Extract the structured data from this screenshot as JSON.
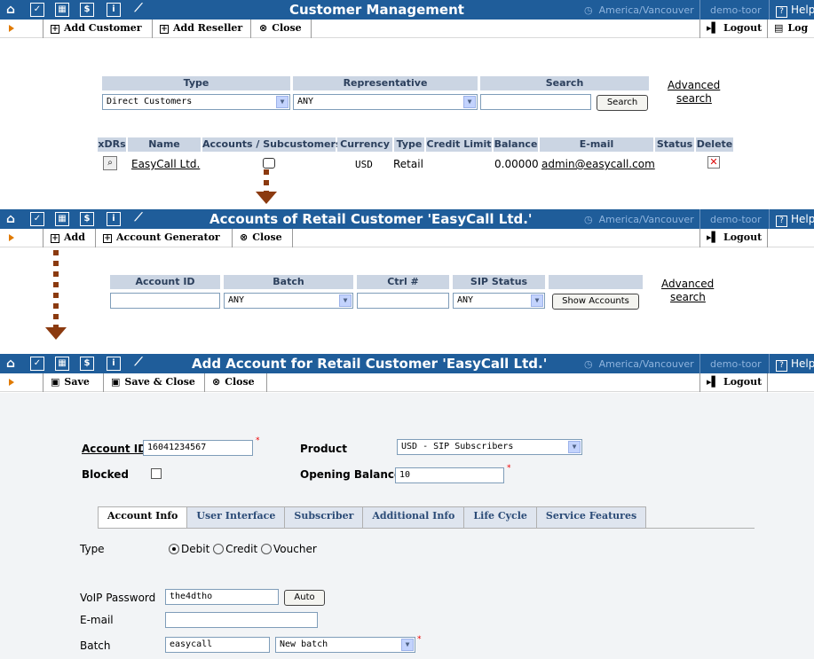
{
  "common": {
    "timezone": "America/Vancouver",
    "user": "demo-toor",
    "help": "Help",
    "logout": "Logout",
    "log_label": "Log"
  },
  "screen1": {
    "title": "Customer Management",
    "toolbar": {
      "add_customer": "Add Customer",
      "add_reseller": "Add Reseller",
      "close": "Close"
    },
    "filters": {
      "type_header": "Type",
      "representative_header": "Representative",
      "search_header": "Search",
      "type_value": "Direct Customers",
      "representative_value": "ANY",
      "search_value": "",
      "search_button": "Search",
      "advanced": "Advanced",
      "advanced2": "search"
    },
    "table": {
      "headers": [
        "xDRs",
        "Name",
        "Accounts / Subcustomers",
        "Currency",
        "Type",
        "Credit Limit",
        "Balance",
        "E-mail",
        "Status",
        "Delete"
      ],
      "row": {
        "name": "EasyCall Ltd.",
        "currency": "USD",
        "type": "Retail",
        "credit_limit": "",
        "balance": "0.00000",
        "email": "admin@easycall.com",
        "status": ""
      }
    }
  },
  "screen2": {
    "title": "Accounts of Retail Customer 'EasyCall Ltd.'",
    "toolbar": {
      "add": "Add",
      "account_generator": "Account Generator",
      "close": "Close"
    },
    "filters": {
      "account_id_header": "Account ID",
      "batch_header": "Batch",
      "ctrl_header": "Ctrl #",
      "sip_header": "SIP Status",
      "batch_value": "ANY",
      "sip_value": "ANY",
      "show_button": "Show Accounts",
      "advanced": "Advanced",
      "advanced2": "search"
    }
  },
  "screen3": {
    "title": "Add Account for Retail Customer 'EasyCall Ltd.'",
    "toolbar": {
      "save": "Save",
      "save_close": "Save & Close",
      "close": "Close"
    },
    "form": {
      "account_id_label": "Account ID",
      "account_id_value": "16041234567",
      "product_label": "Product",
      "product_value": "USD - SIP Subscribers",
      "blocked_label": "Blocked",
      "opening_balance_label": "Opening Balance",
      "opening_balance_value": "10"
    },
    "tabs": [
      "Account Info",
      "User Interface",
      "Subscriber",
      "Additional Info",
      "Life Cycle",
      "Service Features"
    ],
    "info": {
      "type_label": "Type",
      "type_options": [
        "Debit",
        "Credit",
        "Voucher"
      ],
      "voip_password_label": "VoIP Password",
      "voip_password_value": "the4dtho",
      "auto_button": "Auto",
      "email_label": "E-mail",
      "email_value": "",
      "batch_label": "Batch",
      "batch_value": "easycall",
      "batch_select": "New batch"
    }
  }
}
